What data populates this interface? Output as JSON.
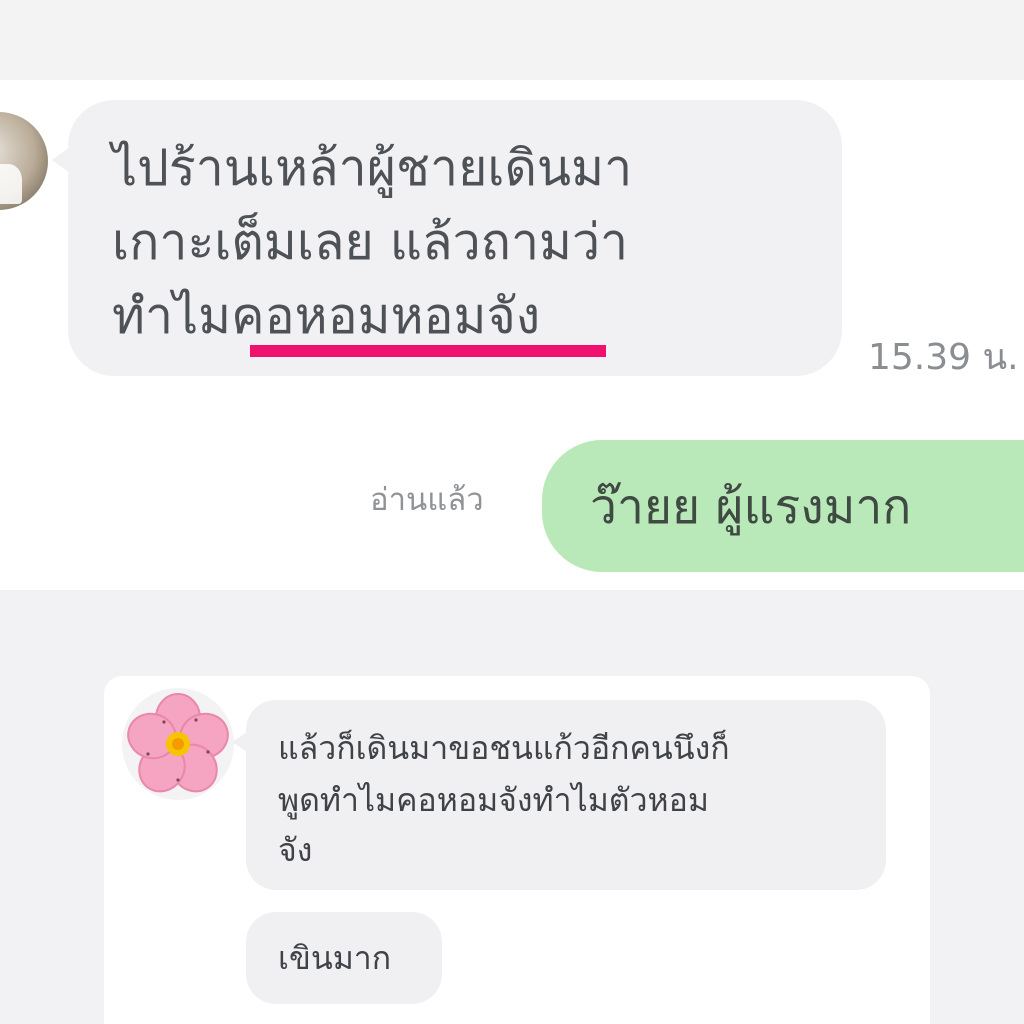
{
  "top_chat": {
    "incoming_message_lines": [
      "ไปร้านเหล้าผู้ชายเดินมา",
      "เกาะเต็มเลย แล้วถามว่า",
      "ทำไมคอหอมหอมจัง"
    ],
    "incoming_time": "15.39 น.",
    "read_status": "อ่านแล้ว",
    "outgoing_message": "ว๊ายย ผู้แรงมาก",
    "underline_color": "#f0116f",
    "outgoing_bubble_color": "#b9e8b9",
    "incoming_bubble_color": "#f1f1f3"
  },
  "bottom_chat": {
    "message_1_lines": [
      "แล้วก็เดินมาขอชนแก้วอีกคนนึงก็",
      "พูดทำไมคอหอมจังทำไมตัวหอม",
      "จัง"
    ],
    "message_2": "เขินมาก",
    "avatar_icon": "pink-flower-icon",
    "bubble_color": "#f0f0f2"
  }
}
